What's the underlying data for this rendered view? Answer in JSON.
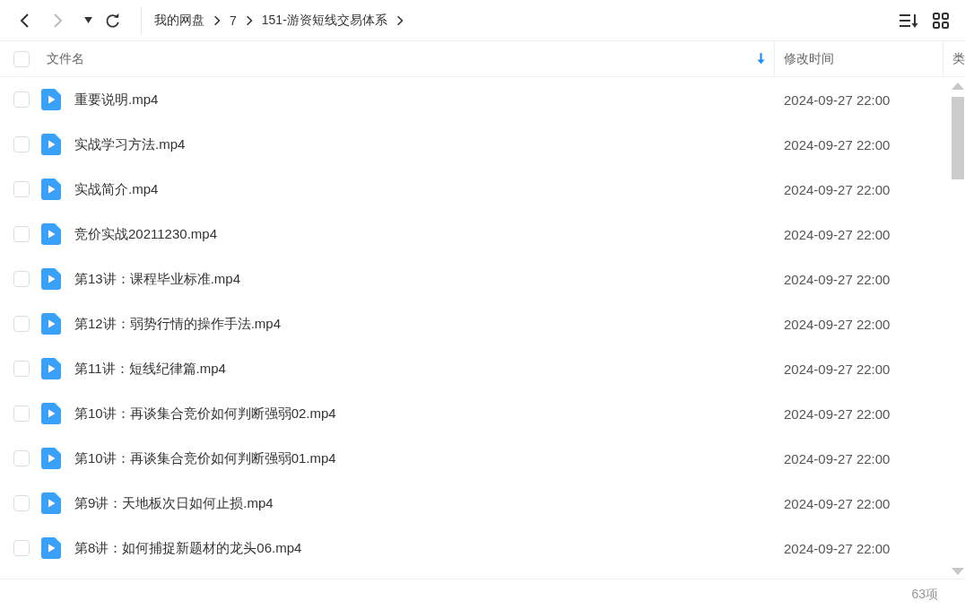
{
  "breadcrumb": [
    "我的网盘",
    "7",
    "151-游资短线交易体系"
  ],
  "table": {
    "select_all": {
      "checked": false
    },
    "columns": [
      {
        "label": "文件名",
        "sorted": true
      },
      {
        "label": "修改时间",
        "sorted": false
      },
      {
        "label": "类",
        "sorted": false
      }
    ],
    "rows": [
      {
        "name": "重要说明.mp4",
        "modified": "2024-09-27 22:00",
        "checked": false
      },
      {
        "name": "实战学习方法.mp4",
        "modified": "2024-09-27 22:00",
        "checked": false
      },
      {
        "name": "实战简介.mp4",
        "modified": "2024-09-27 22:00",
        "checked": false
      },
      {
        "name": "竞价实战20211230.mp4",
        "modified": "2024-09-27 22:00",
        "checked": false
      },
      {
        "name": "第13讲：课程毕业标准.mp4",
        "modified": "2024-09-27 22:00",
        "checked": false
      },
      {
        "name": "第12讲：弱势行情的操作手法.mp4",
        "modified": "2024-09-27 22:00",
        "checked": false
      },
      {
        "name": "第11讲：短线纪律篇.mp4",
        "modified": "2024-09-27 22:00",
        "checked": false
      },
      {
        "name": "第10讲：再谈集合竞价如何判断强弱02.mp4",
        "modified": "2024-09-27 22:00",
        "checked": false
      },
      {
        "name": "第10讲：再谈集合竞价如何判断强弱01.mp4",
        "modified": "2024-09-27 22:00",
        "checked": false
      },
      {
        "name": "第9讲：天地板次日如何止损.mp4",
        "modified": "2024-09-27 22:00",
        "checked": false
      },
      {
        "name": "第8讲：如何捕捉新题材的龙头06.mp4",
        "modified": "2024-09-27 22:00",
        "checked": false
      }
    ]
  },
  "status_bar": {
    "count": "63项"
  }
}
